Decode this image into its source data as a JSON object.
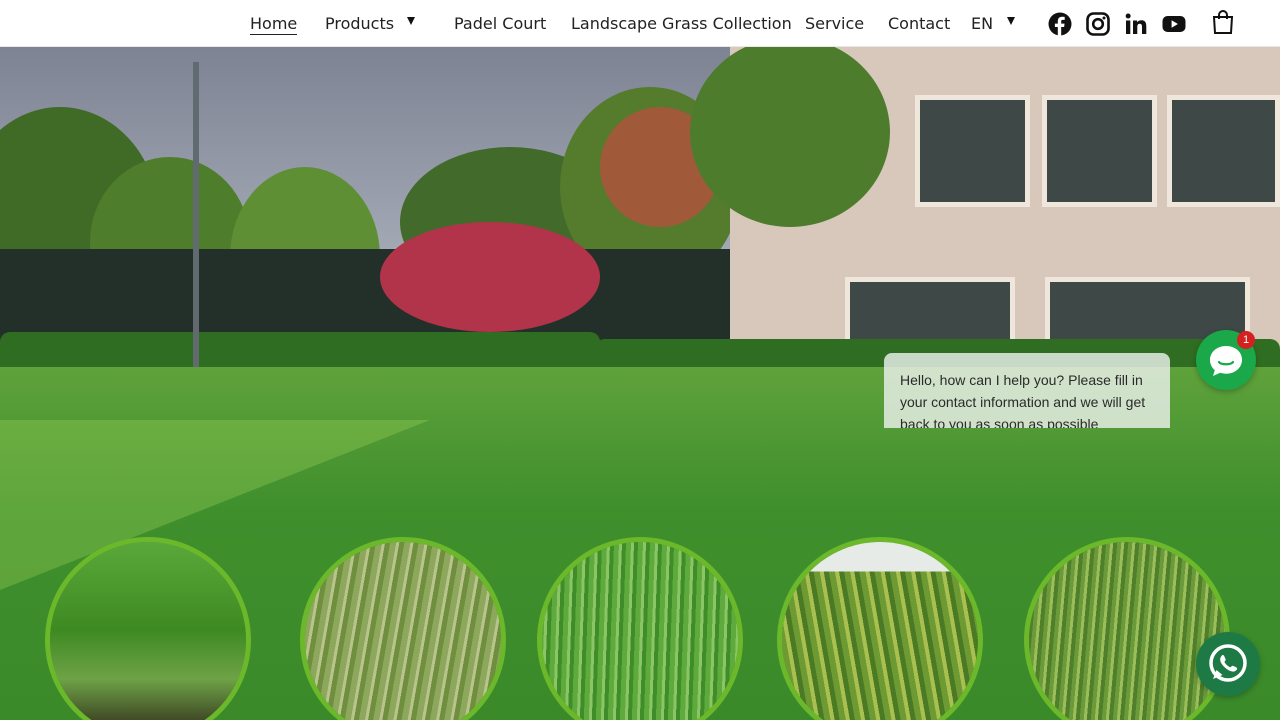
{
  "nav": {
    "items": [
      {
        "label": "Home",
        "active": true
      },
      {
        "label": "Products",
        "has_dropdown": true
      },
      {
        "label": "Padel Court"
      },
      {
        "label": "Landscape Grass Collection"
      },
      {
        "label": "Service"
      },
      {
        "label": "Contact"
      }
    ],
    "language": "EN",
    "social_icons": [
      "facebook-icon",
      "instagram-icon",
      "linkedin-icon",
      "youtube-icon"
    ],
    "cart_icon": "shopping-bag-icon"
  },
  "hero": {
    "image": "lawn-and-building-photo",
    "products": [
      {
        "icon": "grass-sample-1"
      },
      {
        "icon": "grass-sample-2"
      },
      {
        "icon": "grass-sample-3"
      },
      {
        "icon": "grass-sample-4"
      },
      {
        "icon": "grass-sample-5"
      }
    ]
  },
  "chat": {
    "message": "Hello, how can I help you? Please fill in your contact information and we will get back to you as soon as possible",
    "badge_count": "1",
    "chat_icon": "chat-bubble-icon",
    "whatsapp_icon": "whatsapp-icon"
  },
  "colors": {
    "accent_green": "#6bb82a",
    "chat_green": "#1aa84a",
    "whatsapp_green": "#1e7a44",
    "badge_red": "#d42020"
  }
}
